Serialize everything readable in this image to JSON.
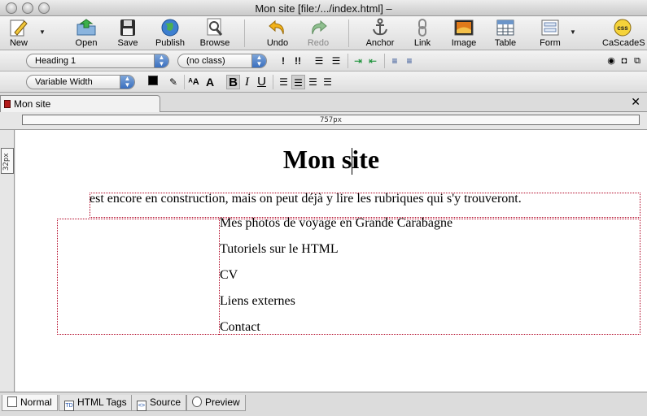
{
  "window": {
    "title": "Mon site [file:/.../index.html] –"
  },
  "toolbar": {
    "buttons": [
      {
        "label": "New",
        "icon": "pencil-page-icon"
      },
      {
        "label": "Open",
        "icon": "folder-open-icon"
      },
      {
        "label": "Save",
        "icon": "floppy-save-icon"
      },
      {
        "label": "Publish",
        "icon": "globe-publish-icon"
      },
      {
        "label": "Browse",
        "icon": "magnifier-browse-icon"
      },
      {
        "label": "Undo",
        "icon": "undo-arrow-icon"
      },
      {
        "label": "Redo",
        "icon": "redo-arrow-icon"
      },
      {
        "label": "Anchor",
        "icon": "anchor-icon"
      },
      {
        "label": "Link",
        "icon": "chain-link-icon"
      },
      {
        "label": "Image",
        "icon": "image-icon"
      },
      {
        "label": "Table",
        "icon": "table-icon"
      },
      {
        "label": "Form",
        "icon": "form-icon"
      },
      {
        "label": "CaScadeS",
        "icon": "css-icon",
        "badge": "css"
      }
    ]
  },
  "format": {
    "paragraph_style": "Heading 1",
    "class_select": "(no class)",
    "font_select": "Variable Width",
    "text_color": "#000000",
    "bold": "B",
    "italic": "I",
    "underline": "U"
  },
  "tabs": {
    "document_tab": "Mon site",
    "close_symbol": "✕"
  },
  "ruler": {
    "width_label": "757px",
    "height_label": "32px"
  },
  "document": {
    "heading": "Mon site",
    "paragraph": "est encore en construction, mais on peut déjà y lire les rubriques qui s'y trouveront.",
    "links": [
      "Mes photos de voyage en Grande Carabagne",
      "Tutoriels sur le HTML",
      "CV",
      "Liens externes",
      "Contact"
    ]
  },
  "view_tabs": [
    {
      "label": "Normal",
      "icon": "page-icon",
      "active": true
    },
    {
      "label": "HTML Tags",
      "icon": "td-tag-icon",
      "badge": "TD",
      "active": false
    },
    {
      "label": "Source",
      "icon": "source-code-icon",
      "badge": "<>",
      "active": false
    },
    {
      "label": "Preview",
      "icon": "magnifier-preview-icon",
      "active": false
    }
  ]
}
